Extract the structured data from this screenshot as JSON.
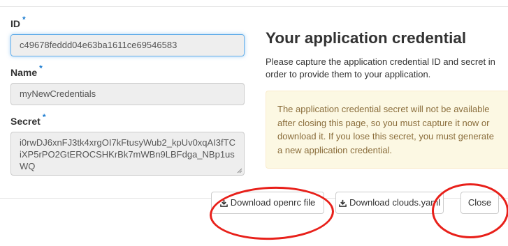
{
  "form": {
    "id": {
      "label": "ID",
      "required_mark": "*",
      "value": "c49678feddd04e63ba1611ce69546583"
    },
    "name": {
      "label": "Name",
      "required_mark": "*",
      "value": "myNewCredentials"
    },
    "secret": {
      "label": "Secret",
      "required_mark": "*",
      "value": "i0rwDJ6xnFJ3tk4xrgOI7kFtusyWub2_kpUv0xqAI3fTCiXP5rPO2GtEROCSHKrBk7mWBn9LBFdga_NBp1usWQ"
    }
  },
  "info": {
    "title": "Your application credential",
    "description": "Please capture the application credential ID and secret in order to provide them to your application.",
    "warning": "The application credential secret will not be available after closing this page, so you must capture it now or download it. If you lose this secret, you must generate a new application credential."
  },
  "footer": {
    "download_openrc_label": "Download openrc file",
    "download_clouds_label": "Download clouds.yaml",
    "close_label": "Close"
  },
  "colors": {
    "required_mark": "#1a7bd0",
    "warning_bg": "#fcf8e3",
    "warning_text": "#8a6d3b",
    "annotation": "#e8201a"
  },
  "icons": {
    "download": "download-icon"
  }
}
